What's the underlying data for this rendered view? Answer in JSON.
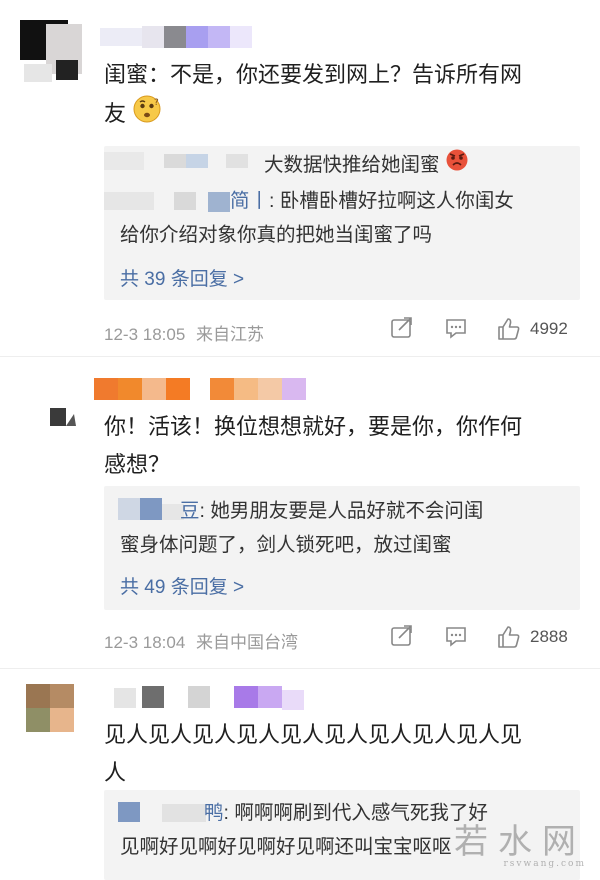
{
  "comments": [
    {
      "text_line1": "闺蜜：不是，你还要发到网上？告诉所有网",
      "text_line2": "友",
      "emoji": "thinking-emoji",
      "reply_top_text": "大数据快推给她闺蜜",
      "reply_top_emoji": "angry-emoji",
      "reply_author_tail": "简丨",
      "reply_text_line1": ": 卧槽卧槽好拉啊这人你闺女",
      "reply_text_line2": "给你介绍对象你真的把她当闺蜜了吗",
      "more_label": "共 39 条回复 >",
      "time": "12-3 18:05",
      "location": "来自江苏",
      "likes": "4992"
    },
    {
      "text_line1": "你！活该！换位想想就好，要是你，你作何",
      "text_line2": "感想？",
      "reply_author_tail": "豆",
      "reply_text_line1": ": 她男朋友要是人品好就不会问闺",
      "reply_text_line2": "蜜身体问题了，剑人锁死吧，放过闺蜜",
      "more_label": "共 49 条回复 >",
      "time": "12-3 18:04",
      "location": "来自中国台湾",
      "likes": "2888"
    },
    {
      "text_line1": "见人见人见人见人见人见人见人见人见人见",
      "text_line2": "人",
      "reply_author_tail": "鸭",
      "reply_text_line1": ": 啊啊啊刷到代入感气死我了好",
      "reply_text_line2": "见啊好见啊好见啊好见啊还叫宝宝呕呕"
    }
  ],
  "watermark": {
    "main": "若水网",
    "sub": "rsvwang.com"
  },
  "colors": {
    "link_blue": "#4a6ea4",
    "reply_bg": "#f3f3f3",
    "meta_gray": "#9a9a9a"
  }
}
